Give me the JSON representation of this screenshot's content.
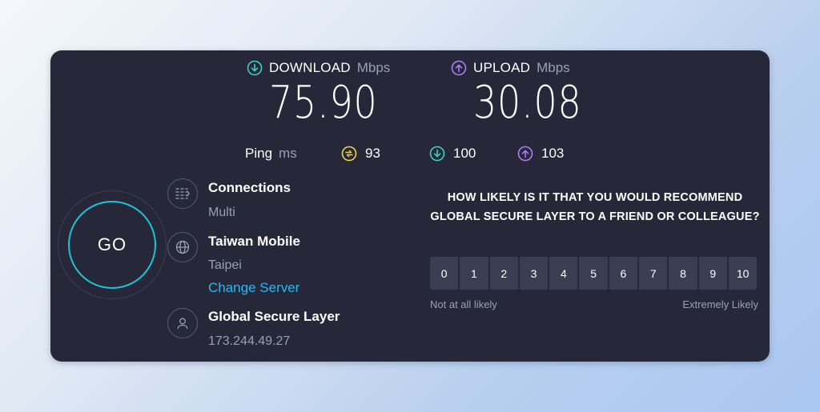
{
  "download": {
    "label": "DOWNLOAD",
    "unit": "Mbps",
    "value": "75.90",
    "icon": "arrow-down-circle-icon",
    "color": "#3ad1c3"
  },
  "upload": {
    "label": "UPLOAD",
    "unit": "Mbps",
    "value": "30.08",
    "icon": "arrow-up-circle-icon",
    "color": "#b07cf2"
  },
  "ping": {
    "label": "Ping",
    "unit": "ms",
    "idle": {
      "value": "93",
      "icon": "jitter-circle-icon",
      "color": "#f2d04a"
    },
    "download": {
      "value": "100",
      "icon": "arrow-down-circle-icon",
      "color": "#3ad1c3"
    },
    "upload": {
      "value": "103",
      "icon": "arrow-up-circle-icon",
      "color": "#b07cf2"
    }
  },
  "go_button": {
    "label": "GO",
    "ring_color": "#1fc4d4"
  },
  "connections": {
    "title": "Connections",
    "value": "Multi",
    "icon": "connections-icon"
  },
  "server": {
    "title": "Taiwan Mobile",
    "location": "Taipei",
    "change_link": "Change Server",
    "icon": "globe-icon"
  },
  "provider": {
    "title": "Global Secure Layer",
    "ip": "173.244.49.27",
    "icon": "user-icon"
  },
  "survey": {
    "question": "HOW LIKELY IS IT THAT YOU WOULD RECOMMEND GLOBAL SECURE LAYER TO A FRIEND OR COLLEAGUE?",
    "scale": [
      "0",
      "1",
      "2",
      "3",
      "4",
      "5",
      "6",
      "7",
      "8",
      "9",
      "10"
    ],
    "low_label": "Not at all likely",
    "high_label": "Extremely Likely"
  }
}
